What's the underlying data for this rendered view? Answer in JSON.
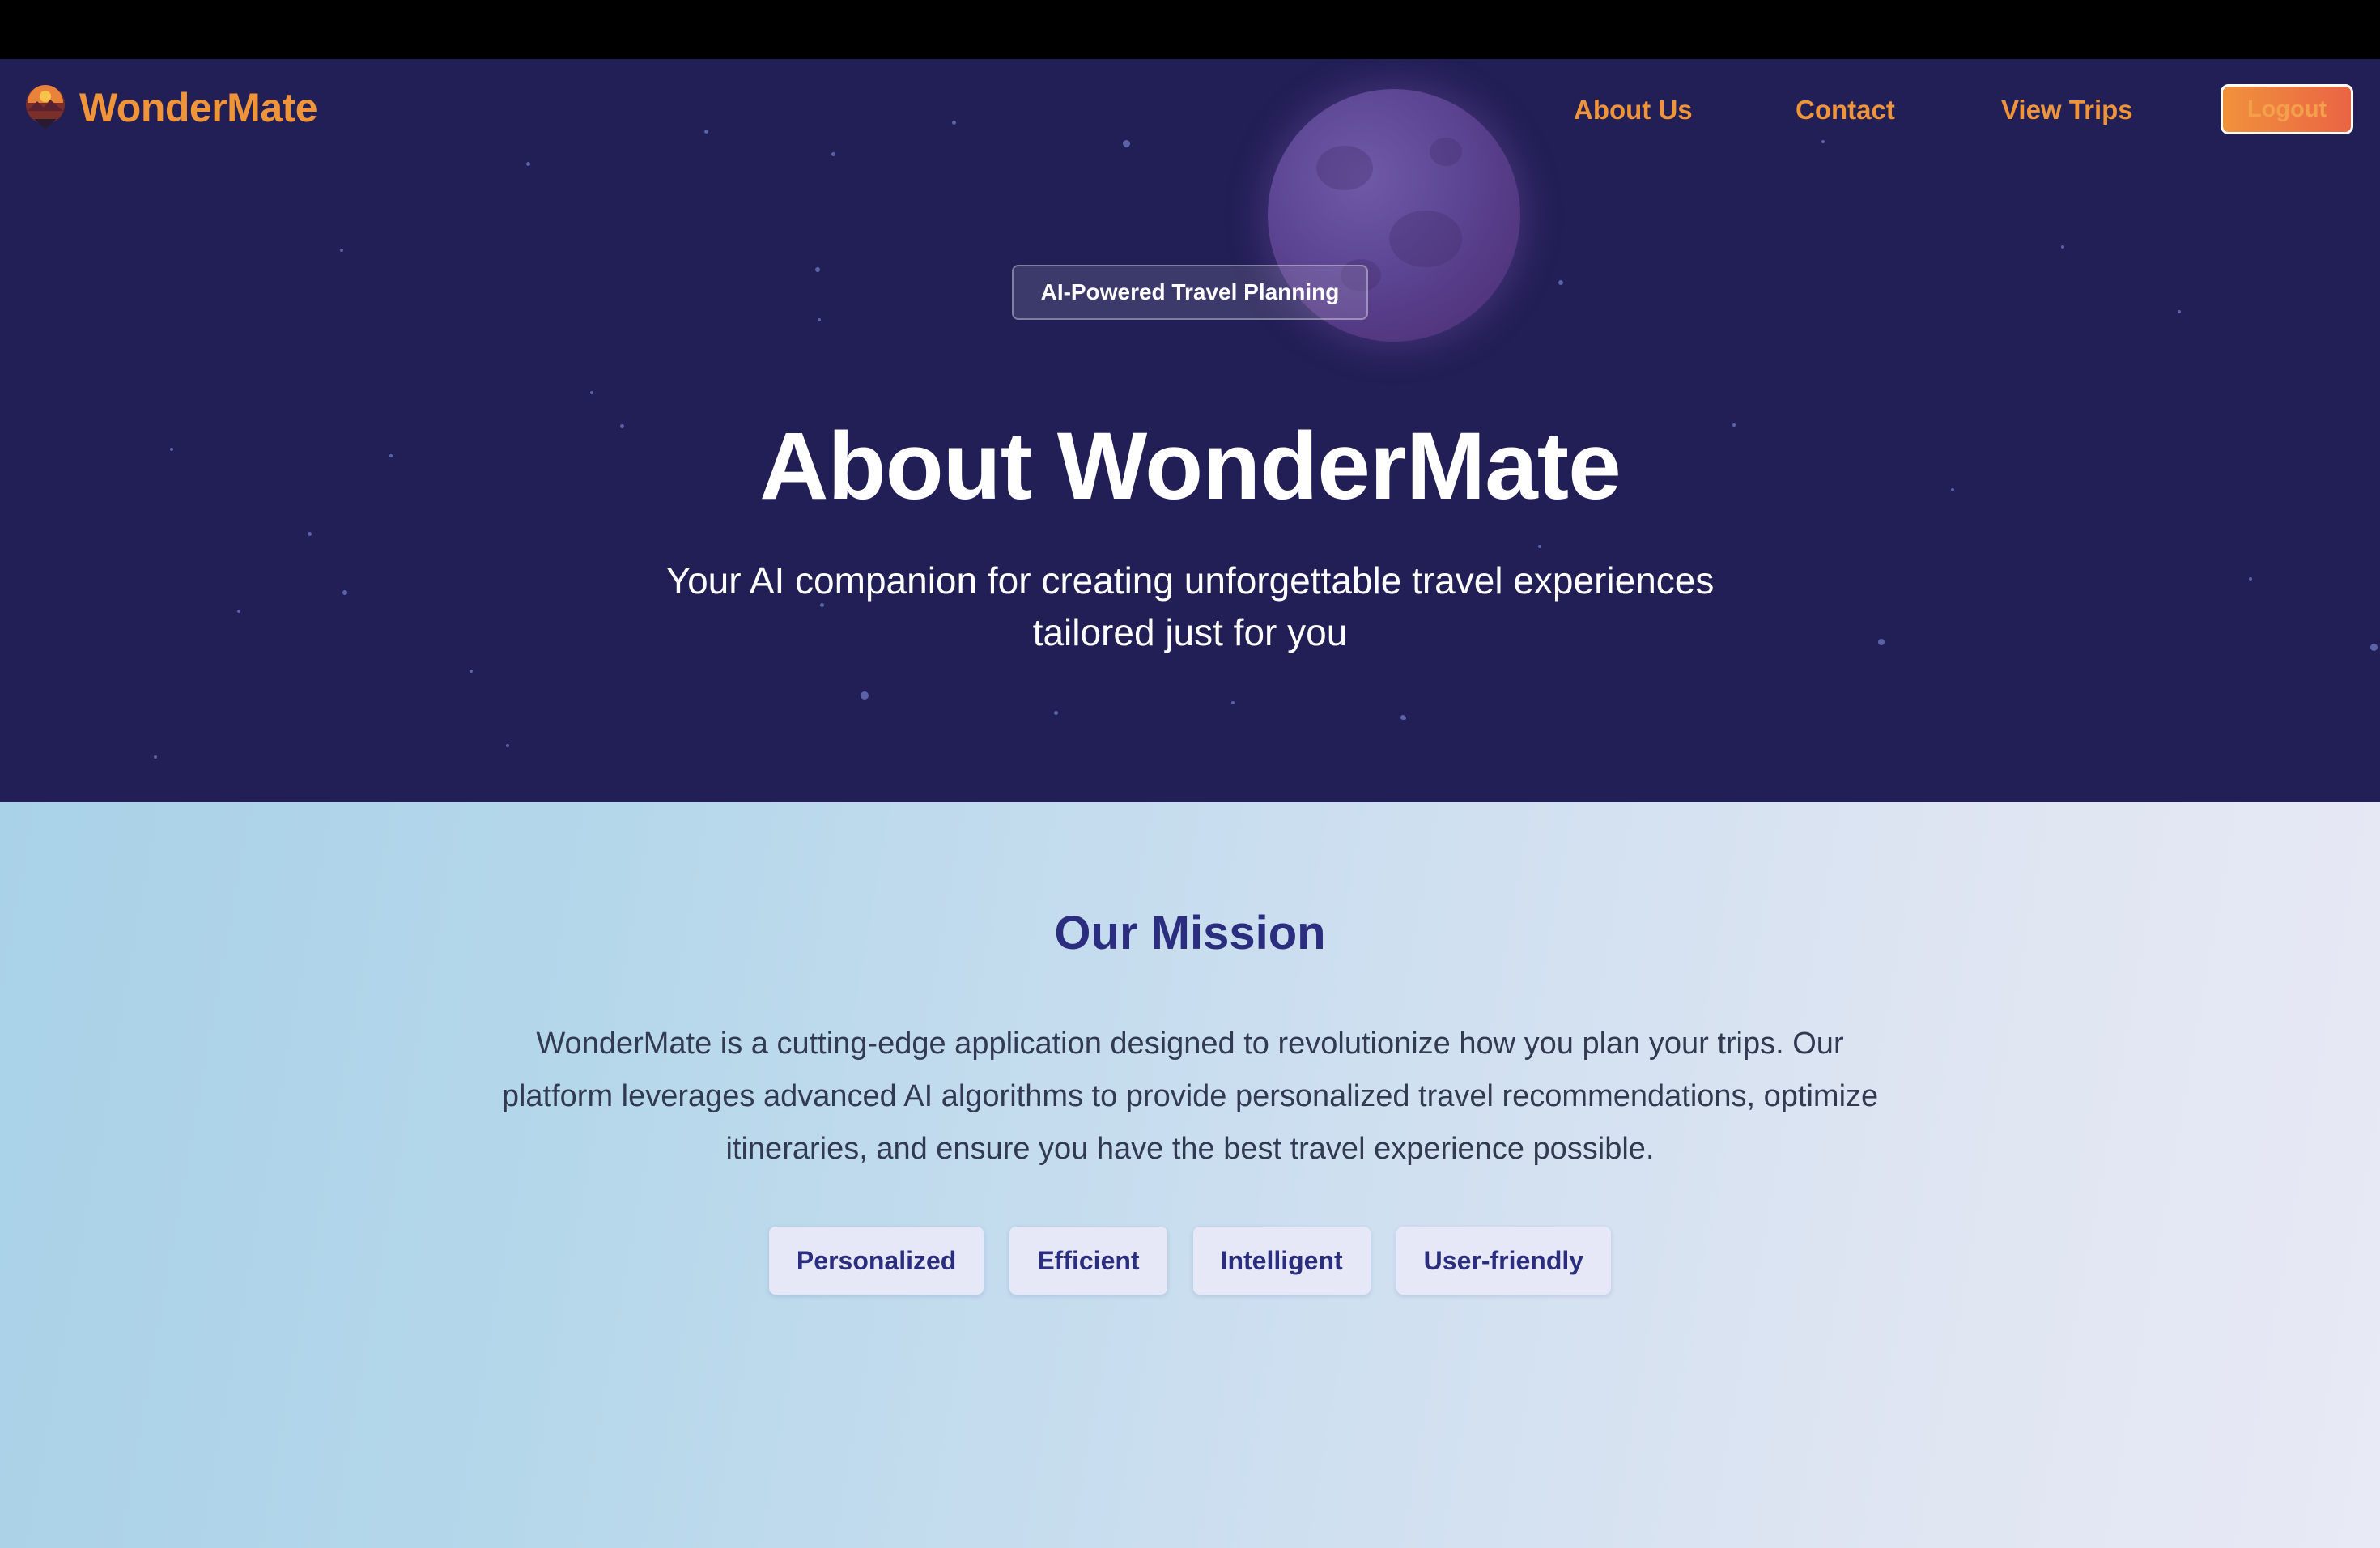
{
  "brand": {
    "name": "WonderMate",
    "logo_icon": "mountain-sunset-icon",
    "color": "#f0943a"
  },
  "nav": {
    "links": [
      {
        "label": "About Us"
      },
      {
        "label": "Contact"
      },
      {
        "label": "View Trips"
      }
    ],
    "logout_label": "Logout"
  },
  "hero": {
    "badge": "AI-Powered Travel Planning",
    "title": "About WonderMate",
    "subtitle": "Your AI companion for creating unforgettable travel experiences tailored just for you",
    "background_color": "#221f56"
  },
  "mission": {
    "title": "Our Mission",
    "text": "WonderMate is a cutting-edge application designed to revolutionize how you plan your trips. Our platform leverages advanced AI algorithms to provide personalized travel recommendations, optimize itineraries, and ensure you have the best travel experience possible.",
    "tags": [
      "Personalized",
      "Efficient",
      "Intelligent",
      "User-friendly"
    ],
    "accent_color": "#2b2e7e"
  }
}
